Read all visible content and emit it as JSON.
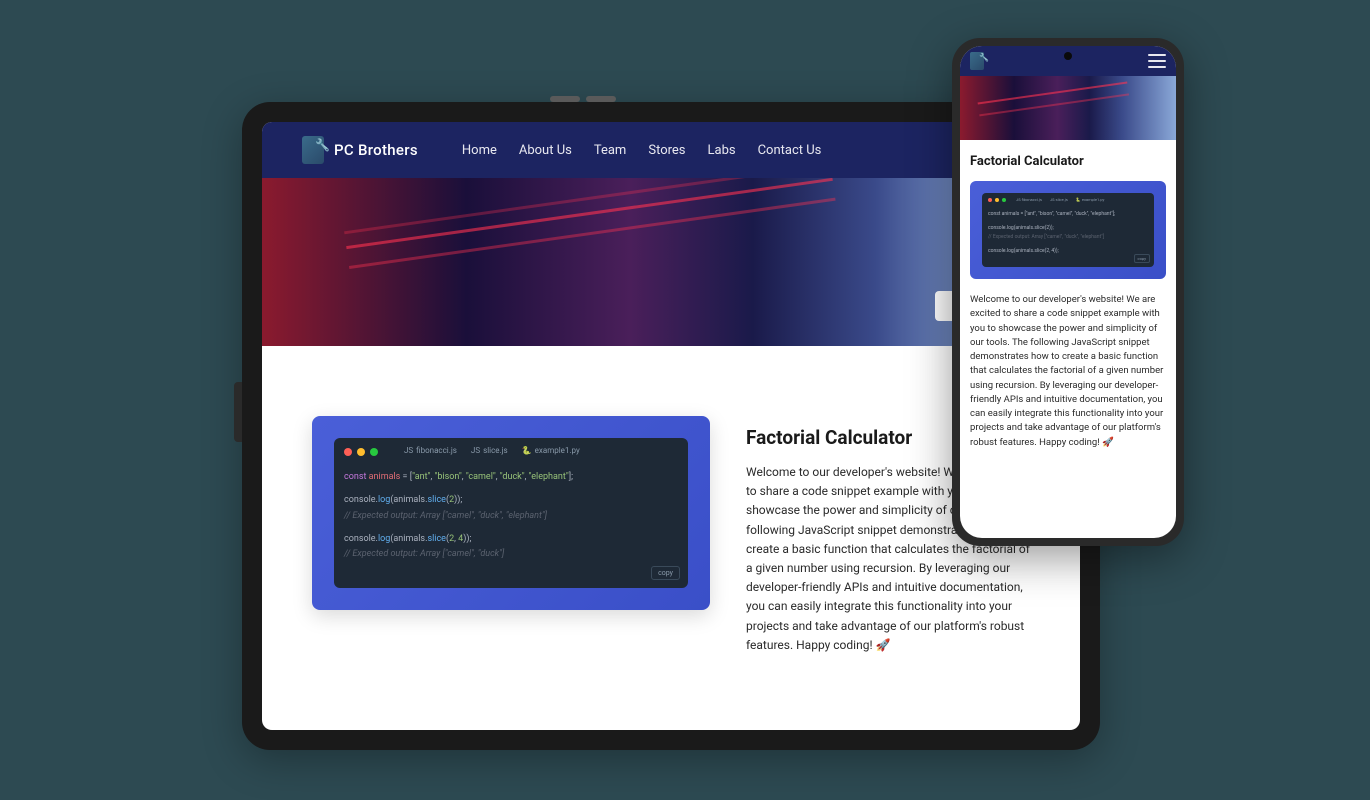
{
  "brand": {
    "name": "PC Brothers"
  },
  "nav": {
    "home": "Home",
    "about": "About Us",
    "team": "Team",
    "stores": "Stores",
    "labs": "Labs",
    "contact": "Contact Us"
  },
  "page": {
    "title": "Factorial Calculator",
    "description": "Welcome to our developer's website! We are excited to share a code snippet example with you to showcase the power and simplicity of our tools. The following JavaScript snippet demonstrates how to create a basic function that calculates the factorial of a given number using recursion. By leveraging our developer-friendly APIs and intuitive documentation, you can easily integrate this functionality into your projects and take advantage of our platform's robust features. Happy coding! 🚀"
  },
  "editor": {
    "tabs": {
      "fibonacci": "fibonacci.js",
      "slice": "slice.js",
      "example": "example1.py"
    },
    "copy_label": "copy",
    "code": {
      "line1_kw": "const",
      "line1_var": " animals ",
      "line1_eq": "= [",
      "line1_s1": "\"ant\"",
      "line1_c1": ", ",
      "line1_s2": "\"bison\"",
      "line1_c2": ", ",
      "line1_s3": "\"camel\"",
      "line1_c3": ", ",
      "line1_s4": "\"duck\"",
      "line1_c4": ", ",
      "line1_s5": "\"elephant\"",
      "line1_end": "];",
      "line2_a": "console.",
      "line2_fn": "log",
      "line2_b": "(animals.",
      "line2_fn2": "slice",
      "line2_c": "(",
      "line2_n": "2",
      "line2_d": "));",
      "line3": "// Expected output: Array [\"camel\", \"duck\", \"elephant\"]",
      "line4_a": "console.",
      "line4_fn": "log",
      "line4_b": "(animals.",
      "line4_fn2": "slice",
      "line4_c": "(",
      "line4_n1": "2",
      "line4_cm": ", ",
      "line4_n2": "4",
      "line4_d": "));",
      "line5": "// Expected output: Array [\"camel\", \"duck\"]"
    },
    "mobile_code": {
      "l1": "const animals = [\"ant\", \"bison\", \"camel\", \"duck\", \"elephant\"];",
      "l2": "console.log(animals.slice(2));",
      "l3": "// Expected output: Array [\"camel\", \"duck\", \"elephant\"]",
      "l4": "console.log(animals.slice(2, 4));"
    }
  }
}
